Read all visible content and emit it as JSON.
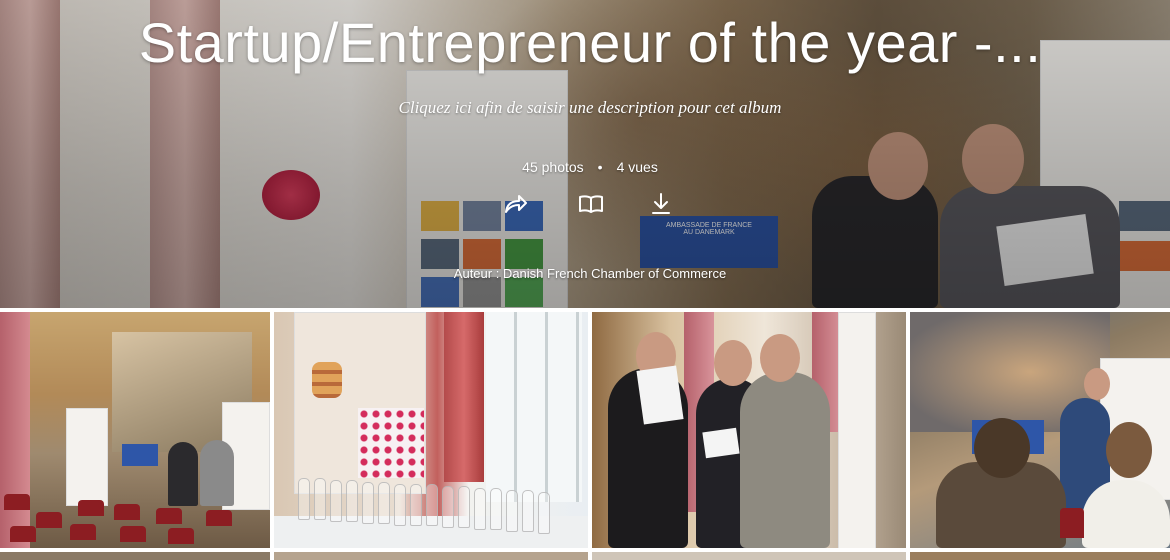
{
  "album": {
    "title": "Startup/Entrepreneur of the year -...",
    "description_placeholder": "Cliquez ici afin de saisir une description pour cet album",
    "photo_count": "45 photos",
    "separator": "•",
    "view_count": "4 vues",
    "author": "Auteur : Danish French Chamber of Commerce"
  },
  "actions": [
    {
      "name": "share",
      "icon": "share-arrow-icon"
    },
    {
      "name": "slideshow",
      "icon": "open-book-icon"
    },
    {
      "name": "download",
      "icon": "download-icon"
    }
  ],
  "photos": [
    {
      "name": "photo-hall-audience"
    },
    {
      "name": "photo-macarons-glasses"
    },
    {
      "name": "photo-three-men-documents"
    },
    {
      "name": "photo-seated-audience"
    }
  ],
  "colors": {
    "overlay_text": "#ffffff",
    "podium_blue": "#2e56a8",
    "chair_red": "#8c1d22"
  }
}
